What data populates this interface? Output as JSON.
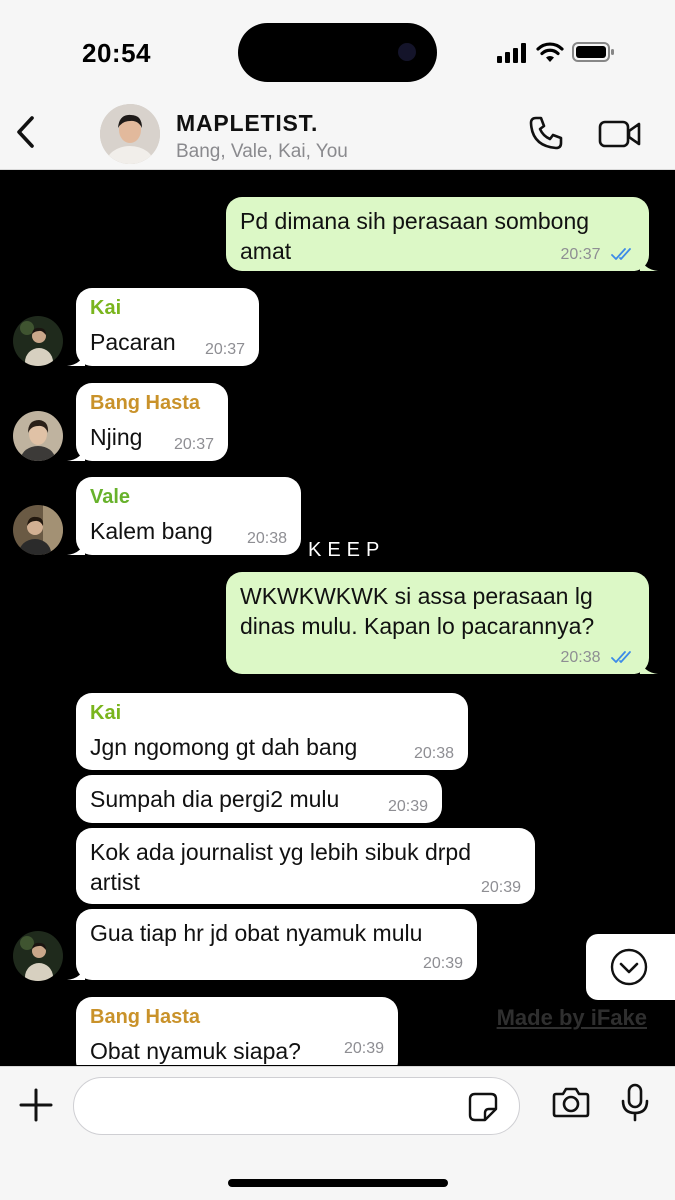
{
  "status_bar": {
    "time": "20:54"
  },
  "header": {
    "title": "MAPLETIST.",
    "members": "Bang, Vale, Kai, You"
  },
  "colors": {
    "out_bubble": "#dcf8c6",
    "in_bubble": "#ffffff",
    "kai_name": "#7ab51d",
    "vale_name": "#68b22c",
    "hasta_name": "#c9922a",
    "read_ticks": "#3d8be8"
  },
  "messages": [
    {
      "from": "You",
      "text": "Pd dimana sih perasaan sombong amat",
      "time": "20:37",
      "status": "read"
    },
    {
      "from": "Kai",
      "text": "Pacaran",
      "time": "20:37"
    },
    {
      "from": "Bang Hasta",
      "text": "Njing",
      "time": "20:37"
    },
    {
      "from": "Vale",
      "text": "Kalem bang",
      "time": "20:38"
    },
    {
      "from": "You",
      "text": "WKWKWKWK si assa perasaan lg dinas mulu. Kapan lo pacarannya?",
      "time": "20:38",
      "status": "read"
    },
    {
      "from": "Kai",
      "text": "Jgn ngomong gt dah bang",
      "time": "20:38"
    },
    {
      "from": "Kai",
      "text": "Sumpah dia pergi2 mulu",
      "time": "20:39"
    },
    {
      "from": "Kai",
      "text": "Kok ada journalist yg lebih sibuk drpd artist",
      "time": "20:39"
    },
    {
      "from": "Kai",
      "text": "Gua tiap hr jd obat nyamuk mulu",
      "time": "20:39"
    },
    {
      "from": "Bang Hasta",
      "text": "Obat nyamuk siapa?",
      "time": "20:39"
    }
  ],
  "overlay": {
    "keep": "KEEP",
    "watermark": "Made by iFake"
  },
  "input": {
    "value": "",
    "placeholder": ""
  },
  "icons": [
    "back-chevron-icon",
    "phone-icon",
    "video-icon",
    "scroll-down-icon",
    "plus-icon",
    "sticker-icon",
    "camera-icon",
    "mic-icon"
  ]
}
